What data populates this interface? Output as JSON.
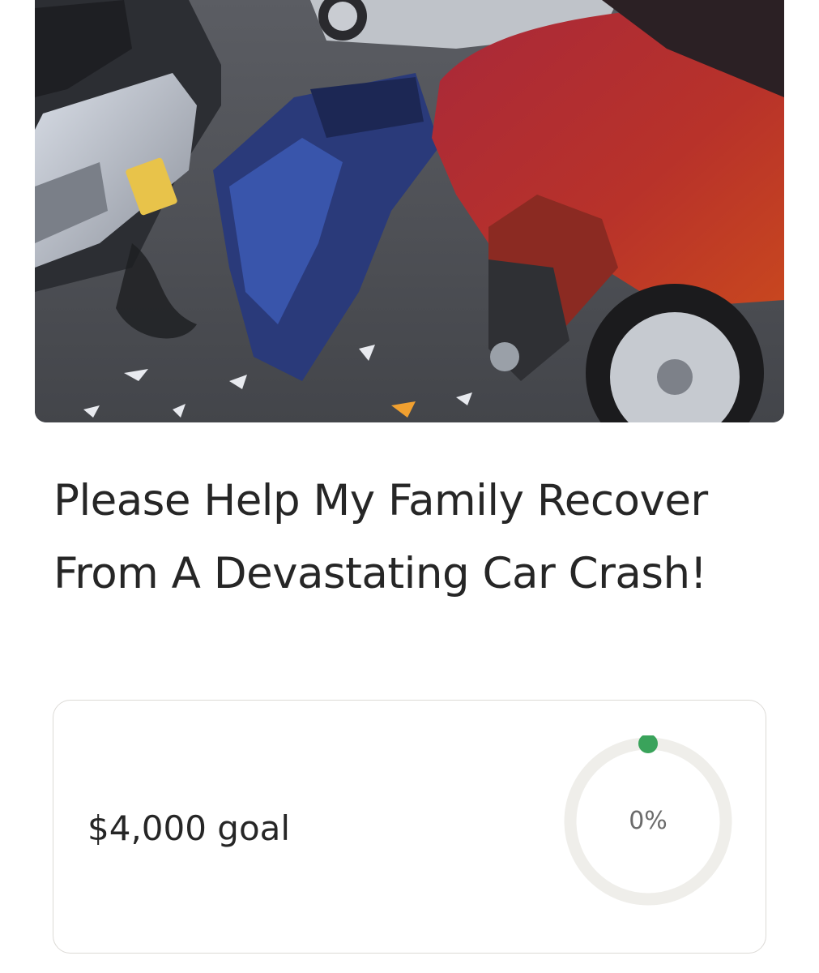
{
  "campaign": {
    "hero_image": {
      "description_icon": "car-crash-photo"
    },
    "title": "Please Help My Family Recover From A Devastating Car Crash!",
    "goal_text": "$4,000 goal",
    "progress": {
      "percent_label": "0%",
      "percent_value": 0
    }
  },
  "colors": {
    "progress_dot": "#3aa35b",
    "ring_track": "#efeeea",
    "title_text": "#262626"
  }
}
